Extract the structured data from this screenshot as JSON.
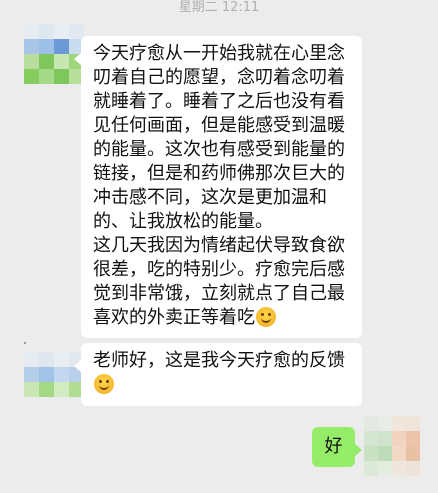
{
  "chat": {
    "timestamp": "星期二 12:11",
    "messages": [
      {
        "sender": "other",
        "lines": [
          "今天疗愈从一开始我就在心里念",
          "叨着自己的愿望，念叨着念叨着",
          "就睡着了。睡着了之后也没有看",
          "见任何画面，但是能感受到温暖",
          "的能量。这次也有感受到能量的",
          "链接，但是和药师佛那次巨大的",
          "冲击感不同，这次是更加温和",
          "的、让我放松的能量。",
          "这几天我因为情绪起伏导致食欲",
          "很差，吃的特别少。疗愈完后感",
          "觉到非常饿，立刻就点了自己最",
          "喜欢的外卖正等着吃"
        ],
        "trailing_emoji": "smiling-face-emoji"
      },
      {
        "sender": "other",
        "lines": [
          "老师好，这是我今天疗愈的反馈",
          ""
        ],
        "trailing_emoji": "smiling-face-emoji"
      },
      {
        "sender": "self",
        "lines": [
          "好"
        ]
      }
    ]
  },
  "colors": {
    "background": "#ececec",
    "incoming_bubble": "#ffffff",
    "outgoing_bubble": "#95ec69",
    "timestamp": "#b0b0b0"
  }
}
